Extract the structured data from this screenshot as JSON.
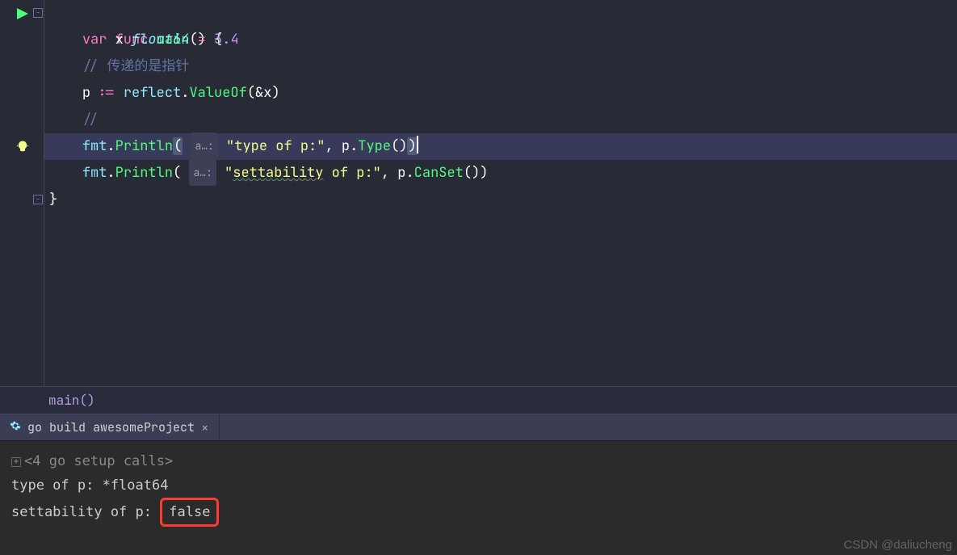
{
  "code": {
    "line1_func": "func",
    "line1_main": "main",
    "line1_rest": "() {",
    "line2_var": "var",
    "line2_x": "x",
    "line2_type": "float64",
    "line2_eq": "=",
    "line2_val": "3.4",
    "line3_comment": "// 传递的是指针",
    "line4_p": "p",
    "line4_decl": ":=",
    "line4_pkg": "reflect",
    "line4_dot1": ".",
    "line4_fn": "ValueOf",
    "line4_args": "(&x)",
    "line5_comment": "//",
    "line6_pkg": "fmt",
    "line6_dot": ".",
    "line6_fn": "Println",
    "line6_open": "(",
    "line6_hint": "a…:",
    "line6_str": "\"type of p:\"",
    "line6_comma": ",",
    "line6_p": "p",
    "line6_dot2": ".",
    "line6_type": "Type",
    "line6_call": "()",
    "line6_close": ")",
    "line7_pkg": "fmt",
    "line7_dot": ".",
    "line7_fn": "Println",
    "line7_open": "(",
    "line7_hint": "a…:",
    "line7_str_pre": "\"",
    "line7_str_wavy": "settability",
    "line7_str_post": " of p:\"",
    "line7_comma": ",",
    "line7_p": "p",
    "line7_dot2": ".",
    "line7_canset": "CanSet",
    "line7_call": "())",
    "line8_close": "}"
  },
  "breadcrumb": {
    "text": "main()"
  },
  "tab": {
    "label": "go build awesomeProject",
    "close": "×"
  },
  "console": {
    "setup_prefix": "<4 go setup calls>",
    "out1": "type of p: *float64",
    "out2_pre": "settability of p:",
    "out2_box": "false"
  },
  "watermark": "CSDN @daliucheng",
  "fold": {
    "minus": "−",
    "plus": "+"
  }
}
